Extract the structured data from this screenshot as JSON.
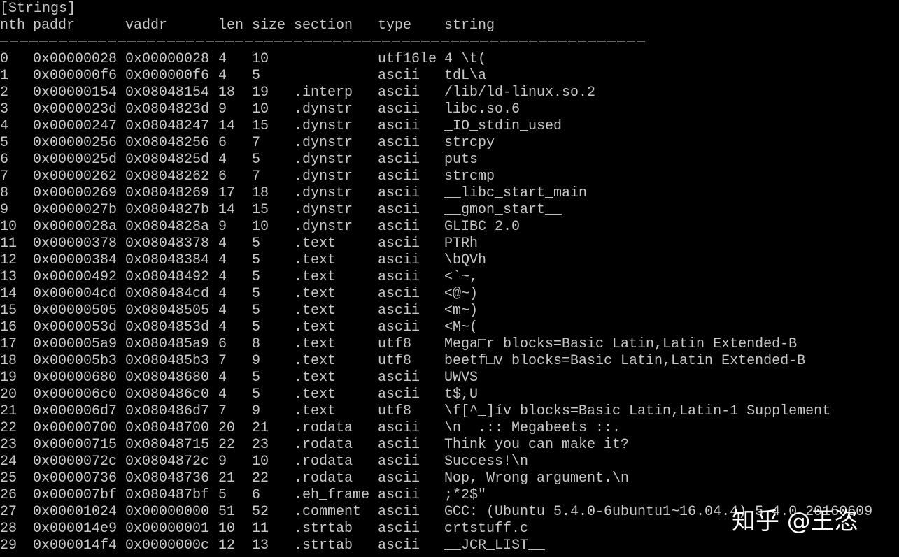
{
  "terminal": {
    "title": "[Strings]",
    "header": {
      "nth": "nth",
      "paddr": "paddr",
      "vaddr": "vaddr",
      "len": "len",
      "size": "size",
      "section": "section",
      "type": "type",
      "string": "string"
    },
    "rule": "――――――――――――――――――――――――――――――――――――――――――――――――――――――――――――――――――",
    "rows": [
      {
        "nth": "0",
        "paddr": "0x00000028",
        "vaddr": "0x00000028",
        "len": "4",
        "size": "10",
        "section": "",
        "type": "utf16le",
        "string": "4 \\t("
      },
      {
        "nth": "1",
        "paddr": "0x000000f6",
        "vaddr": "0x000000f6",
        "len": "4",
        "size": "5",
        "section": "",
        "type": "ascii",
        "string": "tdL\\a"
      },
      {
        "nth": "2",
        "paddr": "0x00000154",
        "vaddr": "0x08048154",
        "len": "18",
        "size": "19",
        "section": ".interp",
        "type": "ascii",
        "string": "/lib/ld-linux.so.2"
      },
      {
        "nth": "3",
        "paddr": "0x0000023d",
        "vaddr": "0x0804823d",
        "len": "9",
        "size": "10",
        "section": ".dynstr",
        "type": "ascii",
        "string": "libc.so.6"
      },
      {
        "nth": "4",
        "paddr": "0x00000247",
        "vaddr": "0x08048247",
        "len": "14",
        "size": "15",
        "section": ".dynstr",
        "type": "ascii",
        "string": "_IO_stdin_used"
      },
      {
        "nth": "5",
        "paddr": "0x00000256",
        "vaddr": "0x08048256",
        "len": "6",
        "size": "7",
        "section": ".dynstr",
        "type": "ascii",
        "string": "strcpy"
      },
      {
        "nth": "6",
        "paddr": "0x0000025d",
        "vaddr": "0x0804825d",
        "len": "4",
        "size": "5",
        "section": ".dynstr",
        "type": "ascii",
        "string": "puts"
      },
      {
        "nth": "7",
        "paddr": "0x00000262",
        "vaddr": "0x08048262",
        "len": "6",
        "size": "7",
        "section": ".dynstr",
        "type": "ascii",
        "string": "strcmp"
      },
      {
        "nth": "8",
        "paddr": "0x00000269",
        "vaddr": "0x08048269",
        "len": "17",
        "size": "18",
        "section": ".dynstr",
        "type": "ascii",
        "string": "__libc_start_main"
      },
      {
        "nth": "9",
        "paddr": "0x0000027b",
        "vaddr": "0x0804827b",
        "len": "14",
        "size": "15",
        "section": ".dynstr",
        "type": "ascii",
        "string": "__gmon_start__"
      },
      {
        "nth": "10",
        "paddr": "0x0000028a",
        "vaddr": "0x0804828a",
        "len": "9",
        "size": "10",
        "section": ".dynstr",
        "type": "ascii",
        "string": "GLIBC_2.0"
      },
      {
        "nth": "11",
        "paddr": "0x00000378",
        "vaddr": "0x08048378",
        "len": "4",
        "size": "5",
        "section": ".text",
        "type": "ascii",
        "string": "PTRh"
      },
      {
        "nth": "12",
        "paddr": "0x00000384",
        "vaddr": "0x08048384",
        "len": "4",
        "size": "5",
        "section": ".text",
        "type": "ascii",
        "string": "\\bQVh"
      },
      {
        "nth": "13",
        "paddr": "0x00000492",
        "vaddr": "0x08048492",
        "len": "4",
        "size": "5",
        "section": ".text",
        "type": "ascii",
        "string": "<`~,"
      },
      {
        "nth": "14",
        "paddr": "0x000004cd",
        "vaddr": "0x080484cd",
        "len": "4",
        "size": "5",
        "section": ".text",
        "type": "ascii",
        "string": "<@~)"
      },
      {
        "nth": "15",
        "paddr": "0x00000505",
        "vaddr": "0x08048505",
        "len": "4",
        "size": "5",
        "section": ".text",
        "type": "ascii",
        "string": "<m~)"
      },
      {
        "nth": "16",
        "paddr": "0x0000053d",
        "vaddr": "0x0804853d",
        "len": "4",
        "size": "5",
        "section": ".text",
        "type": "ascii",
        "string": "<M~("
      },
      {
        "nth": "17",
        "paddr": "0x000005a9",
        "vaddr": "0x080485a9",
        "len": "6",
        "size": "8",
        "section": ".text",
        "type": "utf8",
        "string": "Mega□r blocks=Basic Latin,Latin Extended-B"
      },
      {
        "nth": "18",
        "paddr": "0x000005b3",
        "vaddr": "0x080485b3",
        "len": "7",
        "size": "9",
        "section": ".text",
        "type": "utf8",
        "string": "beetf□v blocks=Basic Latin,Latin Extended-B"
      },
      {
        "nth": "19",
        "paddr": "0x00000680",
        "vaddr": "0x08048680",
        "len": "4",
        "size": "5",
        "section": ".text",
        "type": "ascii",
        "string": "UWVS"
      },
      {
        "nth": "20",
        "paddr": "0x000006c0",
        "vaddr": "0x080486c0",
        "len": "4",
        "size": "5",
        "section": ".text",
        "type": "ascii",
        "string": "t$,U"
      },
      {
        "nth": "21",
        "paddr": "0x000006d7",
        "vaddr": "0x080486d7",
        "len": "7",
        "size": "9",
        "section": ".text",
        "type": "utf8",
        "string": "\\f[^_]ív blocks=Basic Latin,Latin-1 Supplement"
      },
      {
        "nth": "22",
        "paddr": "0x00000700",
        "vaddr": "0x08048700",
        "len": "20",
        "size": "21",
        "section": ".rodata",
        "type": "ascii",
        "string": "\\n  .:: Megabeets ::."
      },
      {
        "nth": "23",
        "paddr": "0x00000715",
        "vaddr": "0x08048715",
        "len": "22",
        "size": "23",
        "section": ".rodata",
        "type": "ascii",
        "string": "Think you can make it?"
      },
      {
        "nth": "24",
        "paddr": "0x0000072c",
        "vaddr": "0x0804872c",
        "len": "9",
        "size": "10",
        "section": ".rodata",
        "type": "ascii",
        "string": "Success!\\n"
      },
      {
        "nth": "25",
        "paddr": "0x00000736",
        "vaddr": "0x08048736",
        "len": "21",
        "size": "22",
        "section": ".rodata",
        "type": "ascii",
        "string": "Nop, Wrong argument.\\n"
      },
      {
        "nth": "26",
        "paddr": "0x000007bf",
        "vaddr": "0x080487bf",
        "len": "5",
        "size": "6",
        "section": ".eh_frame",
        "type": "ascii",
        "string": ";*2$\""
      },
      {
        "nth": "27",
        "paddr": "0x00001024",
        "vaddr": "0x00000000",
        "len": "51",
        "size": "52",
        "section": ".comment",
        "type": "ascii",
        "string": "GCC: (Ubuntu 5.4.0-6ubuntu1~16.04.4) 5.4.0 20160609"
      },
      {
        "nth": "28",
        "paddr": "0x000014e9",
        "vaddr": "0x00000001",
        "len": "10",
        "size": "11",
        "section": ".strtab",
        "type": "ascii",
        "string": "crtstuff.c"
      },
      {
        "nth": "29",
        "paddr": "0x000014f4",
        "vaddr": "0x0000000c",
        "len": "12",
        "size": "13",
        "section": ".strtab",
        "type": "ascii",
        "string": "__JCR_LIST__"
      }
    ]
  },
  "watermark": "知乎 @王恣"
}
